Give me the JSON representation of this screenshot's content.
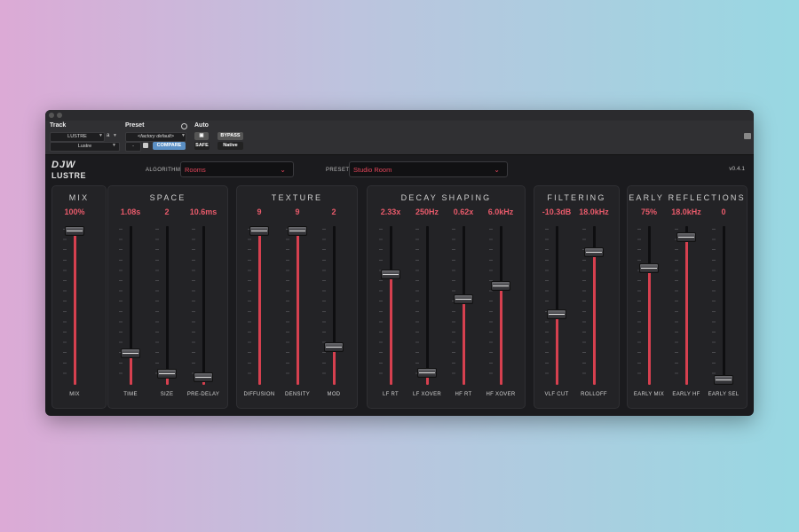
{
  "host": {
    "track_label": "Track",
    "preset_label": "Preset",
    "auto_label": "Auto",
    "track_name": "LUSTRE",
    "track_letter": "a",
    "insert_name": "Lustre",
    "preset_name": "<factory default>",
    "preset_minus": "-",
    "compare_label": "COMPARE",
    "bypass_label": "BYPASS",
    "safe_label": "SAFE",
    "native_label": "Native"
  },
  "plugin": {
    "logo_top": "DJW",
    "logo_bottom": "LUSTRE",
    "algorithm_label": "ALGORITHM",
    "algorithm_value": "Rooms",
    "preset_label": "PRESET",
    "preset_value": "Studio Room",
    "version": "v0.4.1"
  },
  "colors": {
    "accent": "#e2465a",
    "fill": "#d6404f",
    "panel": "#232326"
  },
  "groups": [
    {
      "id": "mix",
      "title": "MIX",
      "faders": [
        {
          "label": "MIX",
          "value": "100%",
          "level": 1.0
        }
      ]
    },
    {
      "id": "space",
      "title": "SPACE",
      "faders": [
        {
          "label": "TIME",
          "value": "1.08s",
          "level": 0.18
        },
        {
          "label": "SIZE",
          "value": "2",
          "level": 0.04
        },
        {
          "label": "PRE-DELAY",
          "value": "10.6ms",
          "level": 0.02
        }
      ]
    },
    {
      "id": "texture",
      "title": "TEXTURE",
      "faders": [
        {
          "label": "DIFFUSION",
          "value": "9",
          "level": 1.0
        },
        {
          "label": "DENSITY",
          "value": "9",
          "level": 1.0
        },
        {
          "label": "MOD",
          "value": "2",
          "level": 0.22
        }
      ]
    },
    {
      "id": "decay",
      "title": "DECAY SHAPING",
      "faders": [
        {
          "label": "LF RT",
          "value": "2.33x",
          "level": 0.71
        },
        {
          "label": "LF XOVER",
          "value": "250Hz",
          "level": 0.05
        },
        {
          "label": "HF RT",
          "value": "0.62x",
          "level": 0.54
        },
        {
          "label": "HF XOVER",
          "value": "6.0kHz",
          "level": 0.63
        }
      ]
    },
    {
      "id": "filtering",
      "title": "FILTERING",
      "faders": [
        {
          "label": "VLF CUT",
          "value": "-10.3dB",
          "level": 0.44
        },
        {
          "label": "ROLLOFF",
          "value": "18.0kHz",
          "level": 0.86
        }
      ]
    },
    {
      "id": "early",
      "title": "EARLY REFLECTIONS",
      "faders": [
        {
          "label": "EARLY MIX",
          "value": "75%",
          "level": 0.75
        },
        {
          "label": "EARLY HF",
          "value": "18.0kHz",
          "level": 0.96
        },
        {
          "label": "EARLY SEL",
          "value": "0",
          "level": 0.0
        }
      ]
    }
  ]
}
